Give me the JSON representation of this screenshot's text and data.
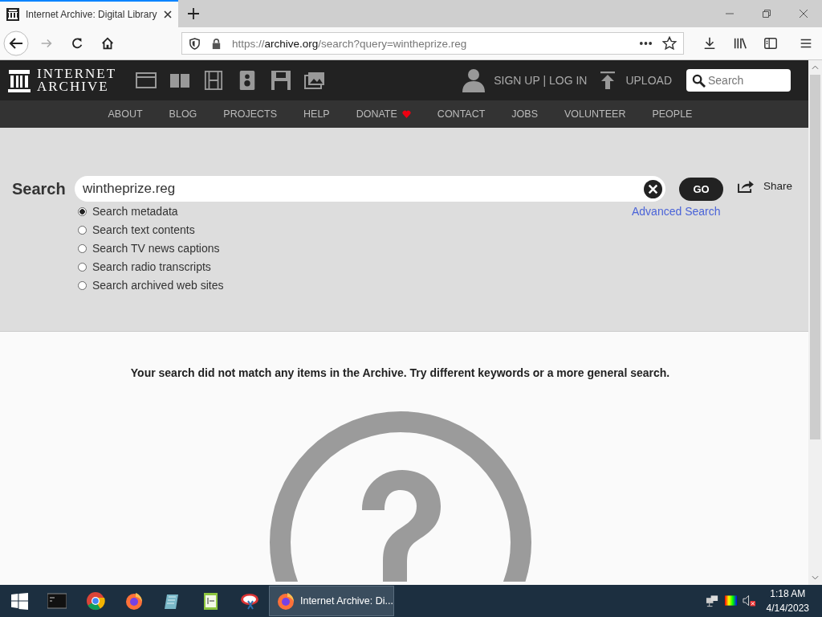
{
  "browser": {
    "tab_title": "Internet Archive: Digital Library",
    "url_prefix": "https://",
    "url_host": "archive.org",
    "url_path": "/search?query=wintheprize.reg"
  },
  "header": {
    "logo_lines": [
      "INTERNET",
      "ARCHIVE"
    ],
    "account": "SIGN UP | LOG IN",
    "upload": "UPLOAD",
    "search_placeholder": "Search"
  },
  "nav": [
    {
      "label": "ABOUT",
      "heart": false
    },
    {
      "label": "BLOG",
      "heart": false
    },
    {
      "label": "PROJECTS",
      "heart": false
    },
    {
      "label": "HELP",
      "heart": false
    },
    {
      "label": "DONATE",
      "heart": true
    },
    {
      "label": "CONTACT",
      "heart": false
    },
    {
      "label": "JOBS",
      "heart": false
    },
    {
      "label": "VOLUNTEER",
      "heart": false
    },
    {
      "label": "PEOPLE",
      "heart": false
    }
  ],
  "search": {
    "label": "Search",
    "value": "wintheprize.reg",
    "go": "GO",
    "share": "Share",
    "advanced": "Advanced Search",
    "options": [
      {
        "label": "Search metadata",
        "selected": true
      },
      {
        "label": "Search text contents",
        "selected": false
      },
      {
        "label": "Search TV news captions",
        "selected": false
      },
      {
        "label": "Search radio transcripts",
        "selected": false
      },
      {
        "label": "Search archived web sites",
        "selected": false
      }
    ]
  },
  "message": "Your search did not match any items in the Archive. Try different keywords or a more general search.",
  "taskbar": {
    "window": "Internet Archive: Di...",
    "time": "1:18 AM",
    "date": "4/14/2023"
  }
}
